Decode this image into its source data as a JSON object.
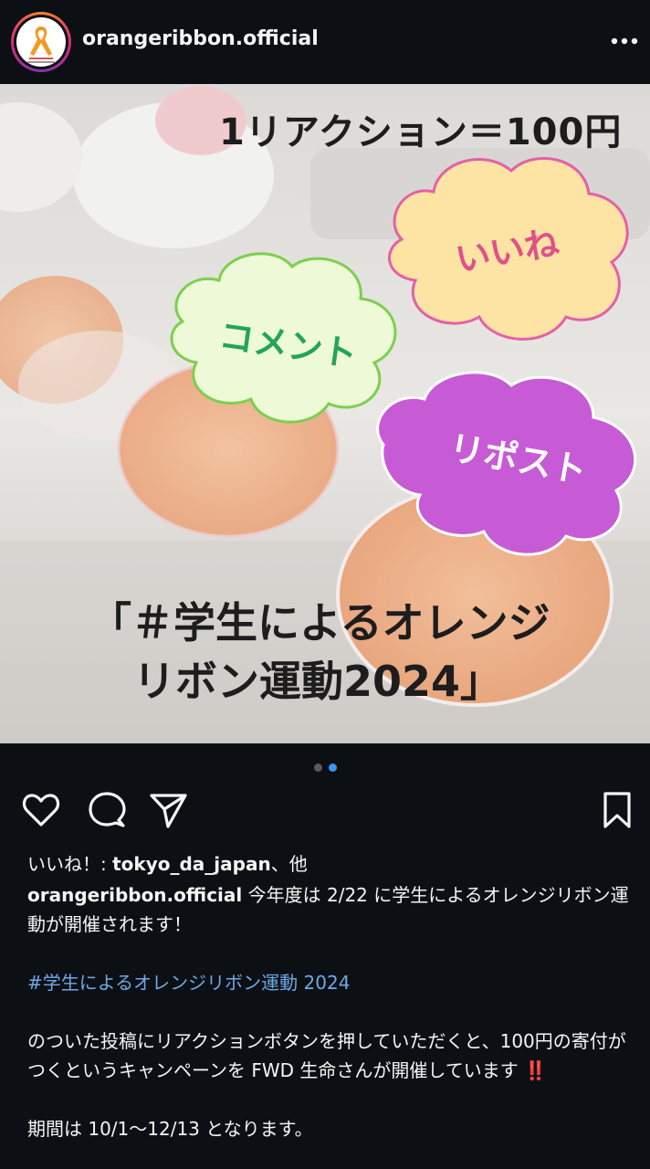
{
  "header": {
    "username": "orangeribbon.official",
    "avatar_icon": "orange-ribbon-logo-icon",
    "more_icon": "more-options-icon"
  },
  "post_image": {
    "reaction_title": "1リアクション＝100円",
    "cloud_like": "いいね",
    "cloud_comment": "コメント",
    "cloud_repost": "リポスト",
    "campaign_line1": "「＃学生によるオレンジ",
    "campaign_line2": "リボン運動2024」"
  },
  "carousel": {
    "count": 2,
    "active_index": 2
  },
  "actions": {
    "like_icon": "heart-icon",
    "comment_icon": "comment-icon",
    "share_icon": "send-icon",
    "save_icon": "bookmark-icon"
  },
  "likes": {
    "prefix": "いいね！: ",
    "user": "tokyo_da_japan",
    "suffix": "、他"
  },
  "caption": {
    "username": "orangeribbon.official",
    "text1": " 今年度は 2/22 に学生によるオレンジリボン運動が開催されます！",
    "hashtag": "#学生によるオレンジリボン運動 2024",
    "text2": "のついた投稿にリアクションボタンを押していただくと、100円の寄付がつくというキャンペーンを FWD 生命さんが開催しています",
    "emoji": "‼️",
    "text3": "期間は 10/1～12/13 となります。"
  },
  "colors": {
    "background": "#0c1014",
    "hashtag": "#6fa8e8",
    "dot_active": "#3897f0",
    "cloud_like_fill": "#fde3a4",
    "cloud_comment_fill": "#eef9d8",
    "cloud_repost_fill": "#c75bd6"
  }
}
